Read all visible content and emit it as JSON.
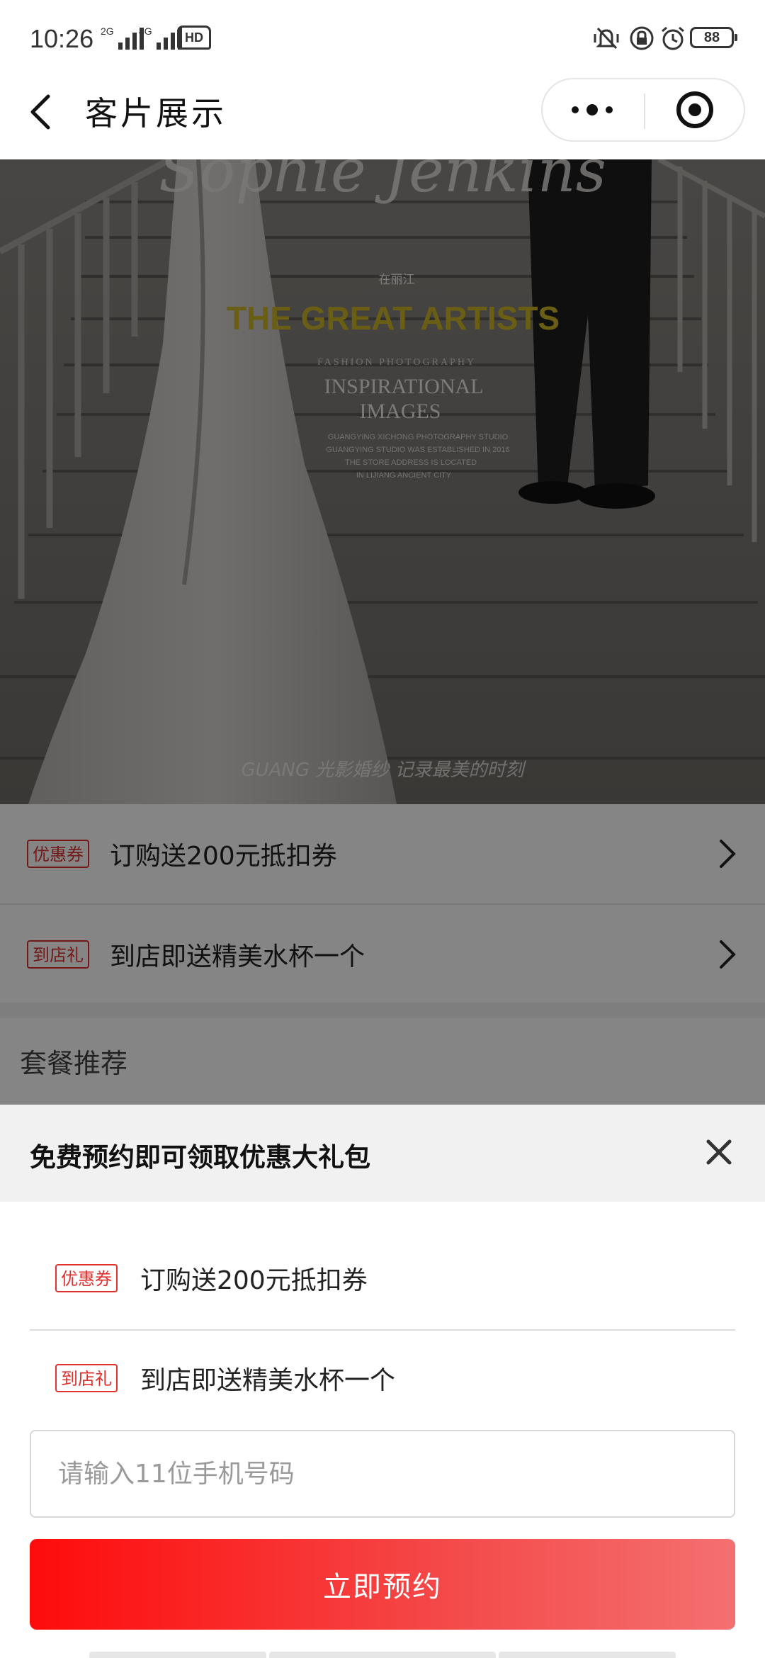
{
  "status_bar": {
    "time": "10:26",
    "sim1_label": "2G",
    "sim2_label": "4G",
    "hd_label": "HD",
    "battery": "88"
  },
  "nav": {
    "title": "客片展示",
    "more_icon": "more-dots-icon",
    "close_icon": "target-circle-icon"
  },
  "hero": {
    "script_title": "Sophie Jenkins",
    "location": "在丽江",
    "headline": "THE GREAT ARTISTS",
    "kicker": "FASHION PHOTOGRAPHY",
    "subhead_1": "INSPIRATIONAL",
    "subhead_2": "IMAGES",
    "body_1": "GUANGYING XICHONG PHOTOGRAPHY STUDIO",
    "body_2": "GUANGYING STUDIO WAS ESTABLISHED IN 2016",
    "body_3": "THE STORE ADDRESS IS LOCATED",
    "body_4": "IN LIJIANG ANCIENT CITY",
    "watermark": "GUANG 光影婚纱 记录最美的时刻"
  },
  "coupons": [
    {
      "tag": "优惠券",
      "text": "订购送200元抵扣券"
    },
    {
      "tag": "到店礼",
      "text": "到店即送精美水杯一个"
    }
  ],
  "section": {
    "title": "套餐推荐"
  },
  "sheet": {
    "title": "免费预约即可领取优惠大礼包",
    "rows": [
      {
        "tag": "优惠券",
        "text": "订购送200元抵扣券"
      },
      {
        "tag": "到店礼",
        "text": "到店即送精美水杯一个"
      }
    ],
    "phone_placeholder": "请输入11位手机号码",
    "phone_value": "",
    "submit_label": "立即预约"
  },
  "colors": {
    "accent_red": "#e0312e",
    "button_gradient_start": "#ff0b0b",
    "button_gradient_end": "#f47070"
  }
}
